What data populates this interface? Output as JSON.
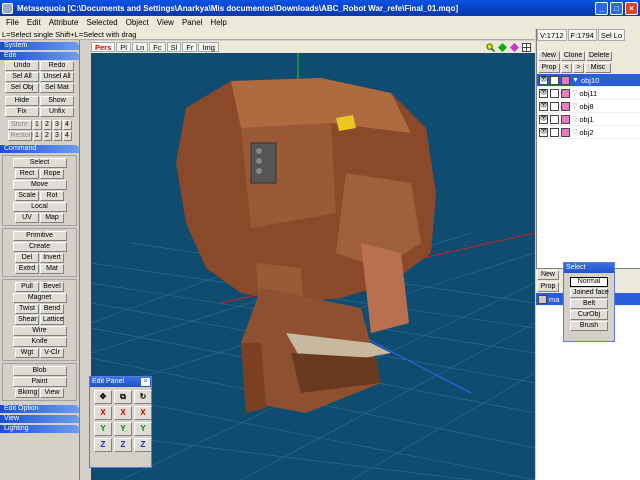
{
  "window": {
    "title": "Metasequoia [C:\\Documents and Settings\\Anarkya\\Mis documentos\\Downloads\\ABC_Robot War_refe\\Final_01.mqo]"
  },
  "menu": [
    "File",
    "Edit",
    "Attribute",
    "Selected",
    "Object",
    "View",
    "Panel",
    "Help"
  ],
  "hint": "L=Select single  Shift+L=Select with drag",
  "left": {
    "system": "System",
    "edit": "Edit",
    "undo": "Undo",
    "redo": "Redo",
    "sel_all": "Sel All",
    "unsel_all": "Unsel All",
    "sel_obj": "Sel Obj",
    "sel_mat": "Sel Mat",
    "hide": "Hide",
    "show": "Show",
    "fix": "Fix",
    "unfix": "Unfix",
    "store": "Store",
    "restore": "Restore",
    "n1": "1",
    "n2": "2",
    "n3": "3",
    "n4": "4",
    "command": "Command",
    "select": "Select",
    "rect": "Rect",
    "rope": "Rope",
    "move": "Move",
    "scale": "Scale",
    "rot": "Rot",
    "local": "Local",
    "uv": "UV",
    "map": "Map",
    "primitive": "Primitive",
    "create": "Create",
    "del": "Del",
    "invert": "Invert",
    "extrd": "Extrd",
    "mat": "Mat",
    "pull": "Pull",
    "bevel": "Bevel",
    "magnet": "Magnet",
    "twist": "Twist",
    "bend": "Bend",
    "shear": "Shear",
    "lattice": "Lattice",
    "wire": "Wire",
    "knife": "Knife",
    "wgt": "Wgt",
    "vclr": "V-Clr",
    "blob": "Blob",
    "paint": "Paint",
    "bkimg": "Bkimg",
    "view": "View",
    "edit_option": "Edit Option",
    "view_sec": "View",
    "lighting": "Lighting"
  },
  "viewbar": {
    "pers": "Pers",
    "pl": "Pl",
    "ln": "Ln",
    "fc": "Fc",
    "sl": "Sl",
    "fr": "Fr",
    "img": "Img"
  },
  "right": {
    "v": "V:1712",
    "f": "F:1794",
    "sel": "Sel Lo",
    "new": "New",
    "clone": "Clone",
    "delete": "Delete",
    "prop": "Prop",
    "lt": "<",
    "gt": ">",
    "misc": "Misc",
    "objects": [
      "obj10",
      "obj11",
      "obj8",
      "obj1",
      "obj2"
    ],
    "mat_new": "New",
    "mat_prop": "Prop",
    "mat_name": "ma"
  },
  "edit_panel": {
    "title": "Edit Panel",
    "close": "×",
    "x": "X",
    "y": "Y",
    "z": "Z"
  },
  "select_panel": {
    "title": "Select",
    "items": [
      "Normal",
      "Joined face",
      "Belt",
      "CurObj",
      "Brush"
    ]
  },
  "colors": {
    "viewport_bg": "#0f4c6f",
    "axis_y": "#22cc22",
    "axis_x": "#cc2222",
    "axis_z": "#3366ff",
    "selection": "#2a5ed8"
  }
}
